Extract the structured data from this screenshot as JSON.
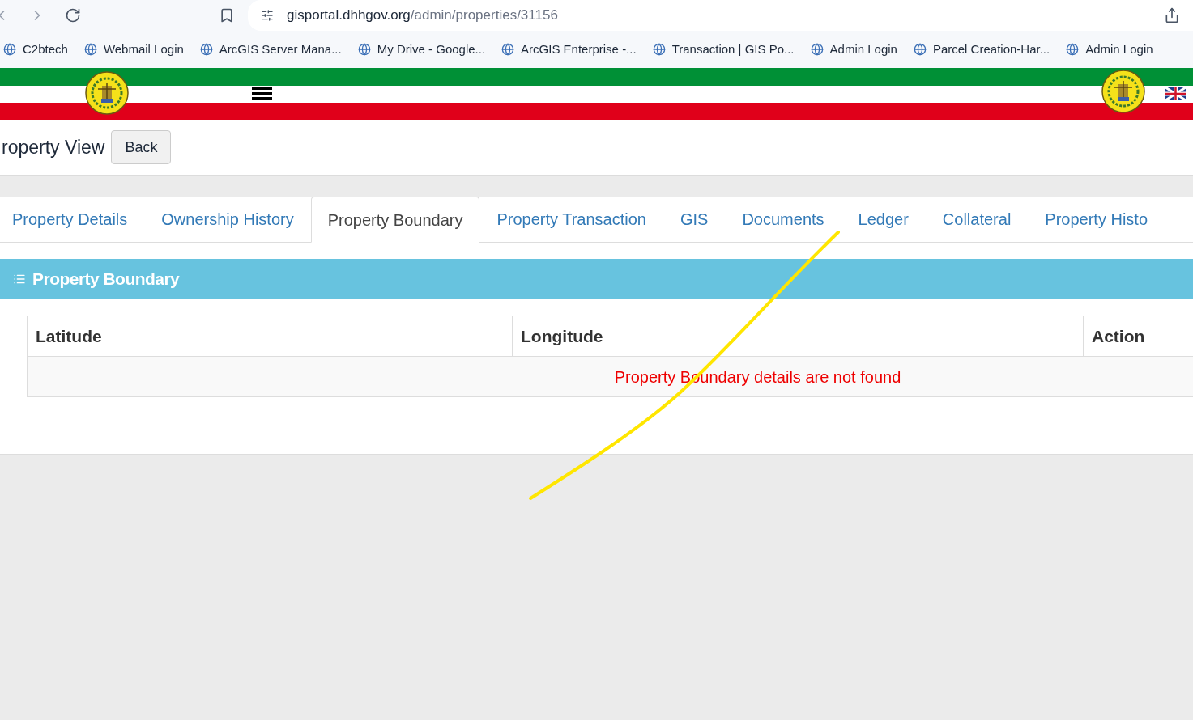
{
  "browser": {
    "url_host": "gisportal.dhhgov.org",
    "url_path": "/admin/properties/31156"
  },
  "bookmarks": [
    {
      "label": "C2btech"
    },
    {
      "label": "Webmail Login"
    },
    {
      "label": "ArcGIS Server Mana..."
    },
    {
      "label": "My Drive - Google..."
    },
    {
      "label": "ArcGIS Enterprise -..."
    },
    {
      "label": "Transaction | GIS Po..."
    },
    {
      "label": "Admin Login"
    },
    {
      "label": "Parcel Creation-Har..."
    },
    {
      "label": "Admin Login"
    }
  ],
  "page": {
    "title": "roperty View",
    "back_button": "Back"
  },
  "tabs": [
    {
      "label": "Property Details",
      "selected": false
    },
    {
      "label": "Ownership History",
      "selected": false
    },
    {
      "label": "Property Boundary",
      "selected": true
    },
    {
      "label": "Property Transaction",
      "selected": false
    },
    {
      "label": "GIS",
      "selected": false
    },
    {
      "label": "Documents",
      "selected": false
    },
    {
      "label": "Ledger",
      "selected": false
    },
    {
      "label": "Collateral",
      "selected": false
    },
    {
      "label": "Property Histo",
      "selected": false
    }
  ],
  "panel": {
    "title": "Property Boundary",
    "table": {
      "columns": [
        "Latitude",
        "Longitude",
        "Action"
      ],
      "empty_message": "Property Boundary details are not found"
    }
  }
}
